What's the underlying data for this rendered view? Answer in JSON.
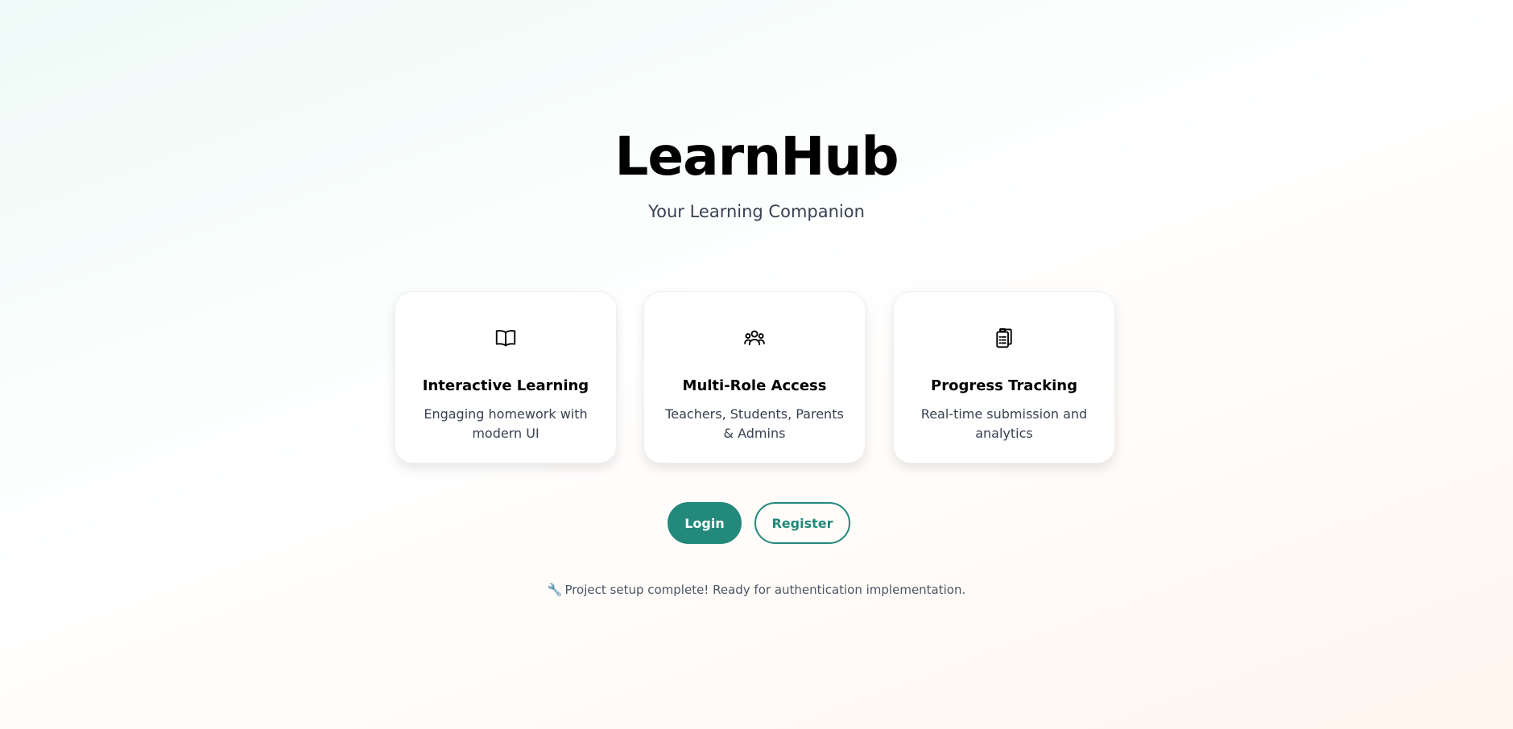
{
  "app": {
    "title": "LearnHub",
    "subtitle": "Your Learning Companion"
  },
  "features": [
    {
      "icon": "book-icon",
      "title": "Interactive Learning",
      "description": "Engaging homework with modern UI"
    },
    {
      "icon": "users-icon",
      "title": "Multi-Role Access",
      "description": "Teachers, Students, Parents & Admins"
    },
    {
      "icon": "clipboard-icon",
      "title": "Progress Tracking",
      "description": "Real-time submission and analytics"
    }
  ],
  "actions": {
    "login_label": "Login",
    "register_label": "Register"
  },
  "status": {
    "icon": "wrench-icon",
    "message": "Project setup complete! Ready for authentication implementation."
  },
  "colors": {
    "accent": "#23897a",
    "title": "#000000",
    "text": "#374151"
  }
}
